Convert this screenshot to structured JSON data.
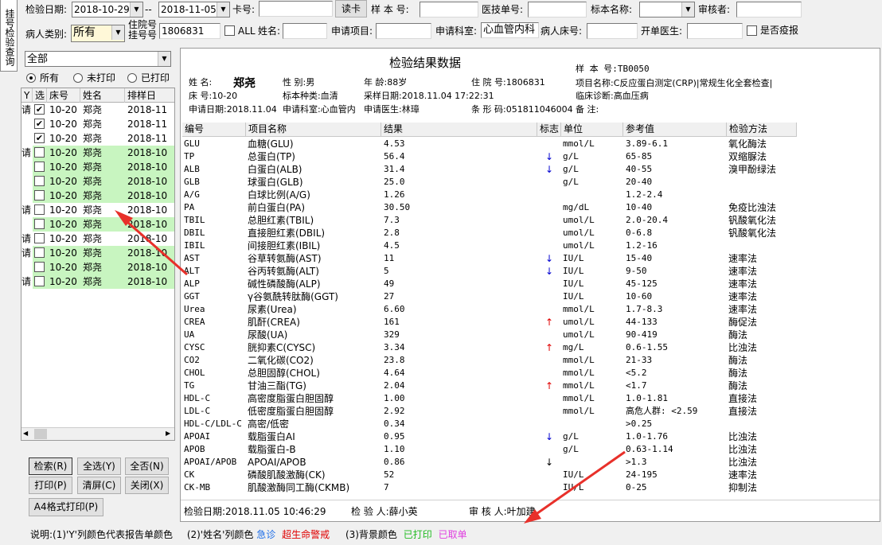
{
  "side_tab": "挂号检验查询",
  "filter": {
    "date_label": "检验日期:",
    "date_from": "2018-10-29",
    "date_sep": "--",
    "date_to": "2018-11-05",
    "card_label": "卡号:",
    "card_value": "",
    "read_card": "读卡",
    "sample_label": "样 本 号:",
    "sample_value": "",
    "medtech_label": "医技单号:",
    "medtech_value": "",
    "specimen_label": "标本名称:",
    "specimen_value": "",
    "reviewer_label": "审核者:",
    "reviewer_value": "",
    "ptype_label": "病人类别:",
    "ptype_value": "所有",
    "hosp_label_1": "住院号",
    "hosp_label_2": "挂号号",
    "hosp_value": "1806831",
    "all_label": "ALL",
    "name_label": "姓名:",
    "name_value": "",
    "item_label": "申请项目:",
    "item_value": "",
    "dept_label": "申请科室:",
    "dept_value": "心血管内科",
    "bed_label": "病人床号:",
    "bed_value": "",
    "doctor_label": "开单医生:",
    "doctor_value": "",
    "epidemic_label": "是否疫报"
  },
  "left": {
    "scope_value": "全部",
    "radios": [
      "所有",
      "未打印",
      "已打印"
    ],
    "columns": [
      "Y",
      "选",
      "床号",
      "姓名",
      "排样日"
    ],
    "rows": [
      {
        "y": "请",
        "checked": true,
        "bed": "10-20",
        "name": "郑尧",
        "date": "2018-11",
        "bg": "#ffffff"
      },
      {
        "y": "",
        "checked": true,
        "bed": "10-20",
        "name": "郑尧",
        "date": "2018-11",
        "bg": "#ffffff"
      },
      {
        "y": "",
        "checked": true,
        "bed": "10-20",
        "name": "郑尧",
        "date": "2018-11",
        "bg": "#ffffff"
      },
      {
        "y": "请",
        "checked": false,
        "bed": "10-20",
        "name": "郑尧",
        "date": "2018-10",
        "bg": "#c8f5c0"
      },
      {
        "y": "",
        "checked": false,
        "bed": "10-20",
        "name": "郑尧",
        "date": "2018-10",
        "bg": "#c8f5c0"
      },
      {
        "y": "",
        "checked": false,
        "bed": "10-20",
        "name": "郑尧",
        "date": "2018-10",
        "bg": "#c8f5c0"
      },
      {
        "y": "",
        "checked": false,
        "bed": "10-20",
        "name": "郑尧",
        "date": "2018-10",
        "bg": "#c8f5c0"
      },
      {
        "y": "请",
        "checked": false,
        "bed": "10-20",
        "name": "郑尧",
        "date": "2018-10",
        "bg": "#ffffff"
      },
      {
        "y": "",
        "checked": false,
        "bed": "10-20",
        "name": "郑尧",
        "date": "2018-10",
        "bg": "#c8f5c0"
      },
      {
        "y": "请",
        "checked": false,
        "bed": "10-20",
        "name": "郑尧",
        "date": "2018-10",
        "bg": "#ffffff"
      },
      {
        "y": "请",
        "checked": false,
        "bed": "10-20",
        "name": "郑尧",
        "date": "2018-10",
        "bg": "#c8f5c0"
      },
      {
        "y": "",
        "checked": false,
        "bed": "10-20",
        "name": "郑尧",
        "date": "2018-10",
        "bg": "#c8f5c0"
      },
      {
        "y": "请",
        "checked": false,
        "bed": "10-20",
        "name": "郑尧",
        "date": "2018-10",
        "bg": "#c8f5c0"
      }
    ],
    "buttons": {
      "search": "检索(R)",
      "select_all": "全选(Y)",
      "select_none": "全否(N)",
      "print": "打印(P)",
      "clear": "清屏(C)",
      "close": "关闭(X)",
      "a4print": "A4格式打印(P)"
    }
  },
  "report": {
    "title": "检验结果数据",
    "sample_no": "样 本 号:TB0050",
    "name_label": "姓    名:",
    "name_value": "郑尧",
    "sex": "性    别:男",
    "age": "年    龄:88岁",
    "hosp_no": "住 院 号:1806831",
    "item_name": "项目名称:C反应蛋白测定(CRP)|常规生化全套检查|",
    "bed": "床    号:10-20",
    "specimen": "标本种类:血清",
    "collect_date": "采样日期:2018.11.04 17:22:31",
    "diagnosis": "临床诊断:高血压病",
    "apply_date": "申请日期:2018.11.04",
    "apply_dept": "申请科室:心血管内",
    "apply_doctor": "申请医生:林璋",
    "barcode": "条 形 码:051811046004",
    "remark": "备    注:",
    "columns": [
      "编号",
      "项目名称",
      "结果",
      "标志",
      "单位",
      "参考值",
      "检验方法"
    ],
    "rows": [
      {
        "code": "GLU",
        "name": "血糖(GLU)",
        "result": "4.53",
        "flag": "",
        "unit": "mmol/L",
        "ref": "3.89-6.1",
        "method": "氧化酶法"
      },
      {
        "code": "TP",
        "name": "总蛋白(TP)",
        "result": "56.4",
        "flag": "↓",
        "unit": "g/L",
        "ref": "65-85",
        "method": "双缩脲法"
      },
      {
        "code": "ALB",
        "name": "白蛋白(ALB)",
        "result": "31.4",
        "flag": "↓",
        "unit": "g/L",
        "ref": "40-55",
        "method": "溴甲酚绿法"
      },
      {
        "code": "GLB",
        "name": "球蛋白(GLB)",
        "result": "25.0",
        "flag": "",
        "unit": "g/L",
        "ref": "20-40",
        "method": ""
      },
      {
        "code": "A/G",
        "name": "白球比例(A/G)",
        "result": "1.26",
        "flag": "",
        "unit": "",
        "ref": "1.2-2.4",
        "method": ""
      },
      {
        "code": "PA",
        "name": "前白蛋白(PA)",
        "result": "30.50",
        "flag": "",
        "unit": "mg/dL",
        "ref": "10-40",
        "method": "免疫比浊法"
      },
      {
        "code": "TBIL",
        "name": "总胆红素(TBIL)",
        "result": "7.3",
        "flag": "",
        "unit": "umol/L",
        "ref": "2.0-20.4",
        "method": "钒酸氧化法"
      },
      {
        "code": "DBIL",
        "name": "直接胆红素(DBIL)",
        "result": "2.8",
        "flag": "",
        "unit": "umol/L",
        "ref": "0-6.8",
        "method": "钒酸氧化法"
      },
      {
        "code": "IBIL",
        "name": "间接胆红素(IBIL)",
        "result": "4.5",
        "flag": "",
        "unit": "umol/L",
        "ref": "1.2-16",
        "method": ""
      },
      {
        "code": "AST",
        "name": "谷草转氨酶(AST)",
        "result": "11",
        "flag": "↓",
        "unit": "IU/L",
        "ref": "15-40",
        "method": "速率法"
      },
      {
        "code": "ALT",
        "name": "谷丙转氨酶(ALT)",
        "result": "5",
        "flag": "↓",
        "unit": "IU/L",
        "ref": "9-50",
        "method": "速率法"
      },
      {
        "code": "ALP",
        "name": "碱性磷酸酶(ALP)",
        "result": "49",
        "flag": "",
        "unit": "IU/L",
        "ref": "45-125",
        "method": "速率法"
      },
      {
        "code": "GGT",
        "name": "γ谷氨酰转肽酶(GGT)",
        "result": "27",
        "flag": "",
        "unit": "IU/L",
        "ref": "10-60",
        "method": "速率法"
      },
      {
        "code": "Urea",
        "name": "尿素(Urea)",
        "result": "6.60",
        "flag": "",
        "unit": "mmol/L",
        "ref": "1.7-8.3",
        "method": "速率法"
      },
      {
        "code": "CREA",
        "name": "肌酐(CREA)",
        "result": "161",
        "flag": "↑",
        "unit": "umol/L",
        "ref": "44-133",
        "method": "酶促法"
      },
      {
        "code": "UA",
        "name": "尿酸(UA)",
        "result": "329",
        "flag": "",
        "unit": "umol/L",
        "ref": "90-419",
        "method": "酶法"
      },
      {
        "code": "CYSC",
        "name": "胱抑素C(CYSC)",
        "result": "3.34",
        "flag": "↑",
        "unit": "mg/L",
        "ref": "0.6-1.55",
        "method": "比浊法"
      },
      {
        "code": "CO2",
        "name": "二氧化碳(CO2)",
        "result": "23.8",
        "flag": "",
        "unit": "mmol/L",
        "ref": "21-33",
        "method": "酶法"
      },
      {
        "code": "CHOL",
        "name": "总胆固醇(CHOL)",
        "result": "4.64",
        "flag": "",
        "unit": "mmol/L",
        "ref": "<5.2",
        "method": "酶法"
      },
      {
        "code": "TG",
        "name": "甘油三酯(TG)",
        "result": "2.04",
        "flag": "↑",
        "unit": "mmol/L",
        "ref": "<1.7",
        "method": "酶法"
      },
      {
        "code": "HDL-C",
        "name": "高密度脂蛋白胆固醇",
        "result": "1.00",
        "flag": "",
        "unit": "mmol/L",
        "ref": "1.0-1.81",
        "method": "直接法"
      },
      {
        "code": "LDL-C",
        "name": "低密度脂蛋白胆固醇",
        "result": "2.92",
        "flag": "",
        "unit": "mmol/L",
        "ref": "高危人群: <2.59",
        "method": "直接法"
      },
      {
        "code": "HDL-C/LDL-C",
        "name": "高密/低密",
        "result": "0.34",
        "flag": "",
        "unit": "",
        "ref": ">0.25",
        "method": ""
      },
      {
        "code": "APOAI",
        "name": "载脂蛋白AI",
        "result": "0.95",
        "flag": "↓",
        "unit": "g/L",
        "ref": "1.0-1.76",
        "method": "比浊法"
      },
      {
        "code": "APOB",
        "name": "载脂蛋白-B",
        "result": "1.10",
        "flag": "",
        "unit": "g/L",
        "ref": "0.63-1.14",
        "method": "比浊法"
      },
      {
        "code": "APOAI/APOB",
        "name": "APOAI/APOB",
        "result": "0.86",
        "flag": "↓",
        "unit": "",
        "ref": ">1.3",
        "method": "比浊法"
      },
      {
        "code": "CK",
        "name": "磷酸肌酸激酶(CK)",
        "result": "52",
        "flag": "",
        "unit": "IU/L",
        "ref": "24-195",
        "method": "速率法"
      },
      {
        "code": "CK-MB",
        "name": "肌酸激酶同工酶(CKMB)",
        "result": "7",
        "flag": "",
        "unit": "IU/L",
        "ref": "0-25",
        "method": "抑制法"
      }
    ],
    "footer_date": "检验日期:2018.11.05 10:46:29",
    "footer_tester": "检  验  人:薛小英",
    "footer_reviewer": "审  核  人:叶加建"
  },
  "legend": {
    "prefix": "说明:(1)'Y'列颜色代表报告单颜色",
    "part2": "(2)'姓名'列颜色",
    "urgent": "急诊",
    "critical": "超生命警戒",
    "part3": "(3)背景颜色",
    "printed": "已打印",
    "cancelled": "已取单"
  },
  "colors": {
    "printed_bg": "#c8f5c0",
    "urgent": "#1e6ee8",
    "critical": "#e00000",
    "printed_text": "#22bb22",
    "cancelled_text": "#e040e0",
    "annotation_arrow": "#e8302a"
  }
}
